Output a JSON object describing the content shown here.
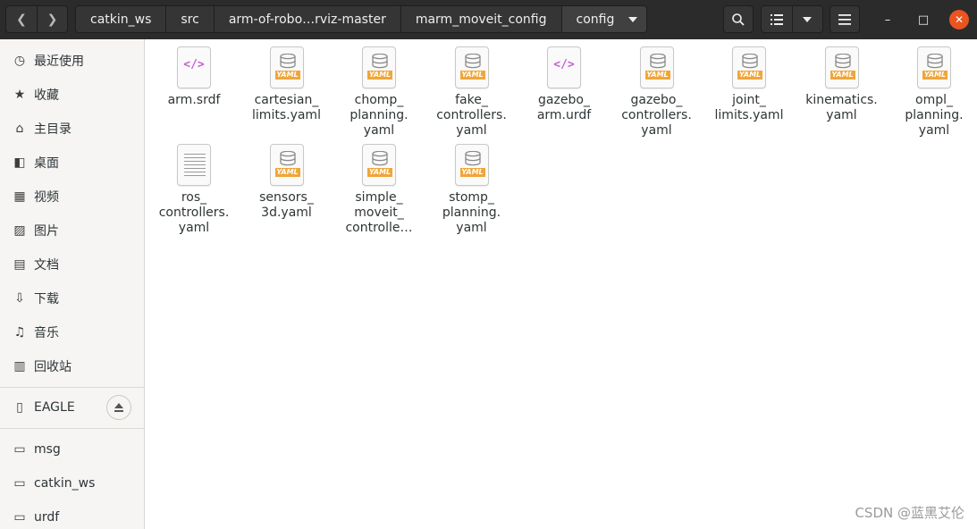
{
  "nav": {
    "back_icon": "chevron-left-icon",
    "forward_icon": "chevron-right-icon"
  },
  "breadcrumbs": [
    "catkin_ws",
    "src",
    "arm-of-robo…rviz-master",
    "marm_moveit_config",
    "config"
  ],
  "toolbar": {
    "search_icon": "search-icon",
    "list_view_icon": "list-view-icon",
    "view_options_icon": "chevron-down-icon",
    "menu_icon": "hamburger-menu-icon"
  },
  "window": {
    "minimize": "–",
    "maximize": "□",
    "close": "✕",
    "close_color": "#e95420"
  },
  "sidebar": {
    "places": [
      {
        "label": "最近使用",
        "icon": "clock-icon",
        "glyph": "◷"
      },
      {
        "label": "收藏",
        "icon": "star-icon",
        "glyph": "★"
      },
      {
        "label": "主目录",
        "icon": "home-icon",
        "glyph": "⌂"
      },
      {
        "label": "桌面",
        "icon": "desktop-icon",
        "glyph": "◧"
      },
      {
        "label": "视频",
        "icon": "video-icon",
        "glyph": "▦"
      },
      {
        "label": "图片",
        "icon": "image-icon",
        "glyph": "▨"
      },
      {
        "label": "文档",
        "icon": "document-icon",
        "glyph": "▤"
      },
      {
        "label": "下载",
        "icon": "download-icon",
        "glyph": "⇩"
      },
      {
        "label": "音乐",
        "icon": "music-icon",
        "glyph": "♫"
      },
      {
        "label": "回收站",
        "icon": "trash-icon",
        "glyph": "▥"
      }
    ],
    "device": {
      "label": "EAGLE",
      "icon": "usb-drive-icon",
      "glyph": "▯"
    },
    "bookmarks": [
      {
        "label": "msg",
        "icon": "folder-icon",
        "glyph": "▭"
      },
      {
        "label": "catkin_ws",
        "icon": "folder-icon",
        "glyph": "▭"
      },
      {
        "label": "urdf",
        "icon": "folder-icon",
        "glyph": "▭"
      }
    ]
  },
  "files": [
    {
      "name": "arm.srdf",
      "type": "xml"
    },
    {
      "name": "cartesian_\nlimits.yaml",
      "type": "yaml"
    },
    {
      "name": "chomp_\nplanning.\nyaml",
      "type": "yaml"
    },
    {
      "name": "fake_\ncontrollers.\nyaml",
      "type": "yaml"
    },
    {
      "name": "gazebo_\narm.urdf",
      "type": "xml"
    },
    {
      "name": "gazebo_\ncontrollers.\nyaml",
      "type": "yaml"
    },
    {
      "name": "joint_\nlimits.yaml",
      "type": "yaml"
    },
    {
      "name": "kinematics.\nyaml",
      "type": "yaml"
    },
    {
      "name": "ompl_\nplanning.\nyaml",
      "type": "yaml"
    },
    {
      "name": "ros_\ncontrollers.\nyaml",
      "type": "text"
    },
    {
      "name": "sensors_\n3d.yaml",
      "type": "yaml"
    },
    {
      "name": "simple_\nmoveit_\ncontrolle…",
      "type": "yaml"
    },
    {
      "name": "stomp_\nplanning.\nyaml",
      "type": "yaml"
    }
  ],
  "file_icon_labels": {
    "xml": "</>",
    "yaml": "YAML"
  },
  "watermark": "CSDN @蓝黑艾伦"
}
